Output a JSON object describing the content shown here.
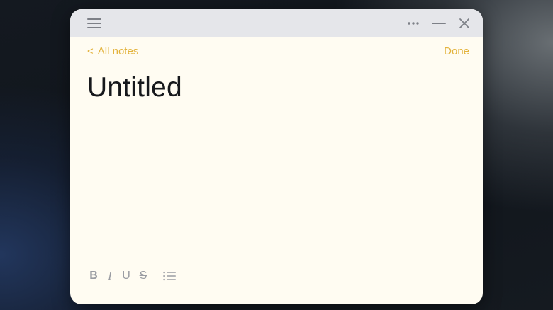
{
  "window": {
    "icons": {
      "menu": "menu-icon",
      "more": "more-icon",
      "minimize": "minimize-icon",
      "close": "close-icon"
    }
  },
  "nav": {
    "back_label": "All notes",
    "back_chevron": "<",
    "done_label": "Done"
  },
  "note": {
    "title": "Untitled",
    "body": ""
  },
  "format_toolbar": {
    "bold": "B",
    "italic": "I",
    "underline": "U",
    "strikethrough": "S",
    "list_icon": "bullet-list-icon"
  },
  "colors": {
    "accent": "#e3b33d",
    "paper": "#fffcf2",
    "titlebar": "#e5e6ea",
    "icon": "#7d8087",
    "title_text": "#16181c"
  }
}
